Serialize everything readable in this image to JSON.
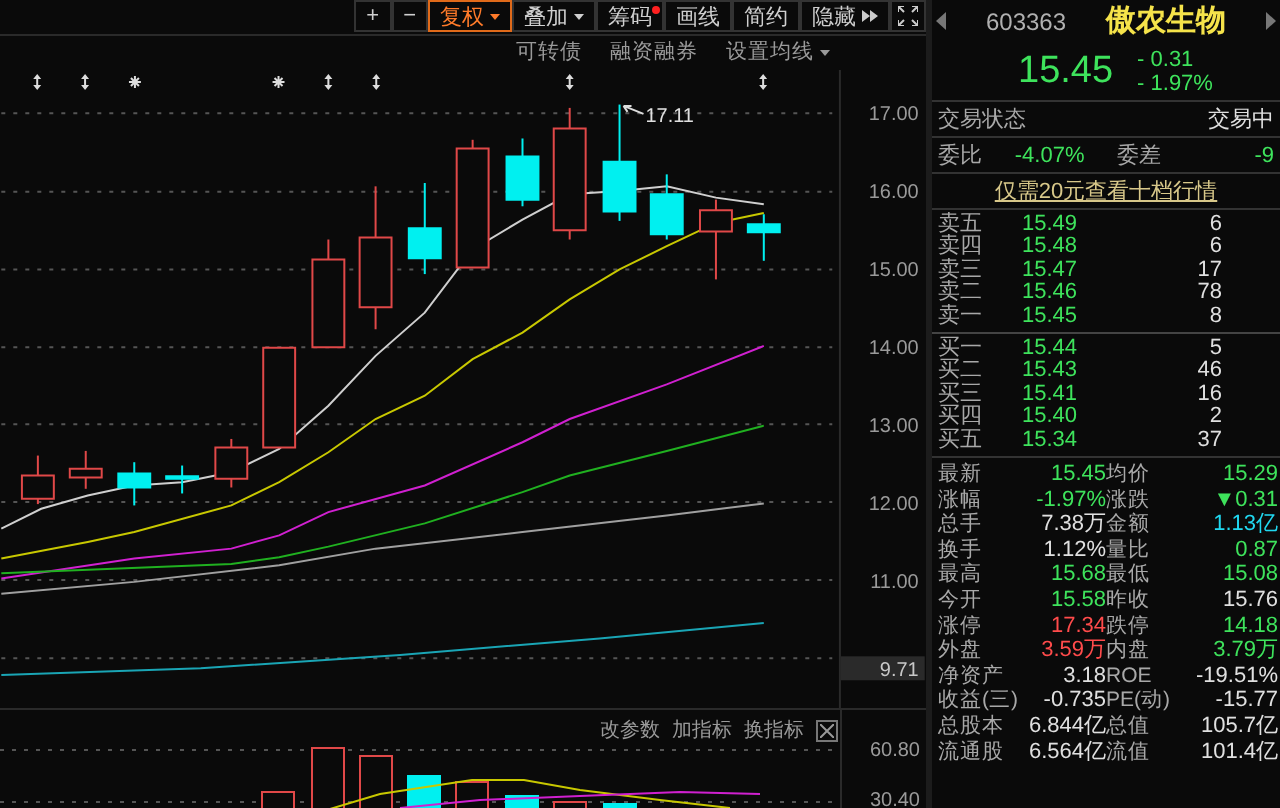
{
  "toolbar": [
    {
      "label": "+",
      "kind": "plain",
      "selected": false
    },
    {
      "label": "−",
      "kind": "plain",
      "selected": false
    },
    {
      "label": "复权",
      "kind": "menu",
      "selected": true
    },
    {
      "label": "叠加",
      "kind": "menu",
      "selected": false
    },
    {
      "label": "筹码",
      "kind": "dot",
      "selected": false
    },
    {
      "label": "画线",
      "kind": "plain",
      "selected": false
    },
    {
      "label": "简约",
      "kind": "plain",
      "selected": false
    },
    {
      "label": "隐藏",
      "kind": "more",
      "selected": false
    }
  ],
  "chart_links": [
    {
      "label": "可转债",
      "kind": "plain"
    },
    {
      "label": "融资融券",
      "kind": "plain"
    },
    {
      "label": "设置均线",
      "kind": "menu"
    }
  ],
  "price_axis": [
    "17.00",
    "16.00",
    "15.00",
    "14.00",
    "13.00",
    "12.00",
    "11.00"
  ],
  "high_marker": "17.11",
  "current_tag": "9.71",
  "indicator_panel": {
    "actions": [
      "改参数",
      "加指标",
      "换指标"
    ],
    "axis": [
      "60.80",
      "30.40"
    ]
  },
  "quote": {
    "code": "603363",
    "name": "傲农生物",
    "price": "15.45",
    "change": "- 0.31",
    "change_pct": "- 1.97%"
  },
  "status": {
    "label": "交易状态",
    "value": "交易中"
  },
  "ratio": [
    {
      "label": "委比",
      "value": "-4.07%"
    },
    {
      "label": "委差",
      "value": "-9"
    }
  ],
  "promo_link": "仅需20元查看十档行情",
  "asks": [
    {
      "label": "卖五",
      "price": "15.49",
      "volume": "6"
    },
    {
      "label": "卖四",
      "price": "15.48",
      "volume": "6"
    },
    {
      "label": "卖三",
      "price": "15.47",
      "volume": "17"
    },
    {
      "label": "卖二",
      "price": "15.46",
      "volume": "78"
    },
    {
      "label": "卖一",
      "price": "15.45",
      "volume": "8"
    }
  ],
  "bids": [
    {
      "label": "买一",
      "price": "15.44",
      "volume": "5"
    },
    {
      "label": "买二",
      "price": "15.43",
      "volume": "46"
    },
    {
      "label": "买三",
      "price": "15.41",
      "volume": "16"
    },
    {
      "label": "买四",
      "price": "15.40",
      "volume": "2"
    },
    {
      "label": "买五",
      "price": "15.34",
      "volume": "37"
    }
  ],
  "stats": [
    {
      "label": "最新",
      "value": "15.45",
      "color": "#3ee35c"
    },
    {
      "label": "均价",
      "value": "15.29",
      "color": "#3ee35c"
    },
    {
      "label": "涨幅",
      "value": "-1.97%",
      "color": "#3ee35c"
    },
    {
      "label": "涨跌",
      "value": "▼0.31",
      "color": "#3ee35c"
    },
    {
      "label": "总手",
      "value": "7.38万",
      "color": "#e0e0e0"
    },
    {
      "label": "金额",
      "value": "1.13亿",
      "color": "#20d8f0"
    },
    {
      "label": "换手",
      "value": "1.12%",
      "color": "#e0e0e0"
    },
    {
      "label": "量比",
      "value": "0.87",
      "color": "#3ee35c"
    },
    {
      "label": "最高",
      "value": "15.68",
      "color": "#3ee35c"
    },
    {
      "label": "最低",
      "value": "15.08",
      "color": "#3ee35c"
    },
    {
      "label": "今开",
      "value": "15.58",
      "color": "#3ee35c"
    },
    {
      "label": "昨收",
      "value": "15.76",
      "color": "#e0e0e0"
    },
    {
      "label": "涨停",
      "value": "17.34",
      "color": "#ff4b4b"
    },
    {
      "label": "跌停",
      "value": "14.18",
      "color": "#3ee35c"
    },
    {
      "label": "外盘",
      "value": "3.59万",
      "color": "#ff4b4b"
    },
    {
      "label": "内盘",
      "value": "3.79万",
      "color": "#3ee35c"
    },
    {
      "label": "净资产",
      "value": "3.18",
      "color": "#e0e0e0"
    },
    {
      "label": "ROE",
      "value": "-19.51%",
      "color": "#e0e0e0"
    },
    {
      "label": "收益(三)",
      "value": "-0.735",
      "color": "#e0e0e0"
    },
    {
      "label": "PE(动)",
      "value": "-15.77",
      "color": "#e0e0e0"
    },
    {
      "label": "总股本",
      "value": "6.844亿",
      "color": "#e0e0e0"
    },
    {
      "label": "总值",
      "value": "105.7亿",
      "color": "#e0e0e0"
    },
    {
      "label": "流通股",
      "value": "6.564亿",
      "color": "#e0e0e0"
    },
    {
      "label": "流值",
      "value": "101.4亿",
      "color": "#e0e0e0"
    }
  ]
}
